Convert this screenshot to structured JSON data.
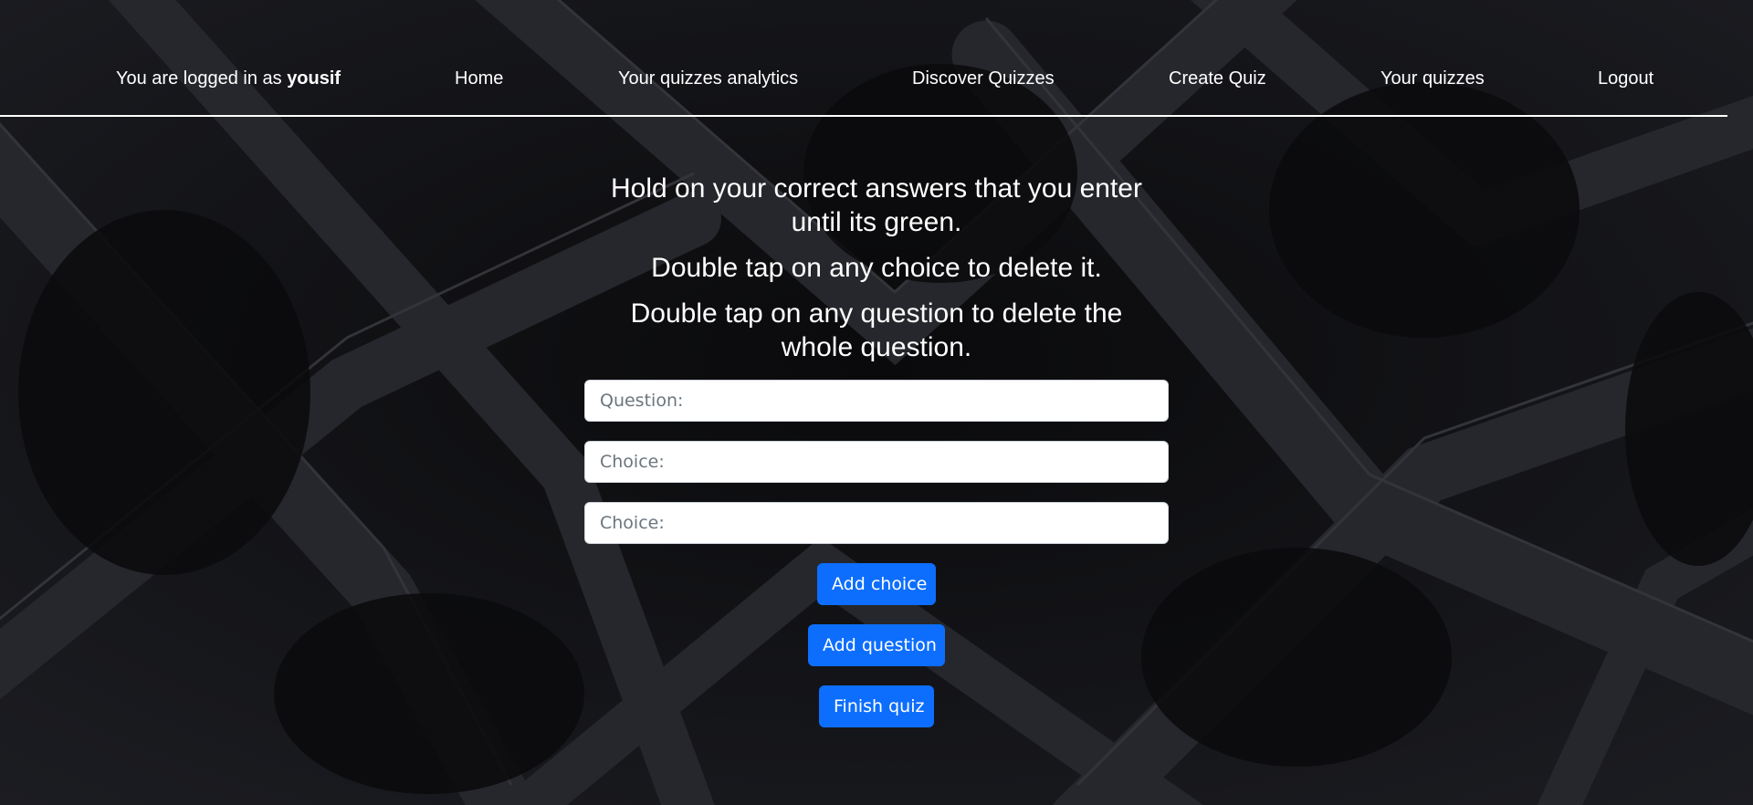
{
  "nav": {
    "user_prefix": "You are logged in as ",
    "username": "yousif",
    "home": "Home",
    "analytics": "Your quizzes analytics",
    "discover": "Discover Quizzes",
    "create": "Create Quiz",
    "your_quizzes": "Your quizzes",
    "logout": "Logout"
  },
  "instructions": [
    "Hold on your correct answers that you enter until its green.",
    "Double tap on any choice to delete it.",
    "Double tap on any question to delete the whole question."
  ],
  "form": {
    "question_placeholder": "Question:",
    "question_value": "",
    "choice_placeholder": "Choice:",
    "choices": [
      "",
      ""
    ],
    "add_choice": "Add choice",
    "add_question": "Add question",
    "finish": "Finish quiz"
  },
  "colors": {
    "primary_button": "#0d6efd",
    "background": "#0d0d0f",
    "text": "#ffffff"
  }
}
